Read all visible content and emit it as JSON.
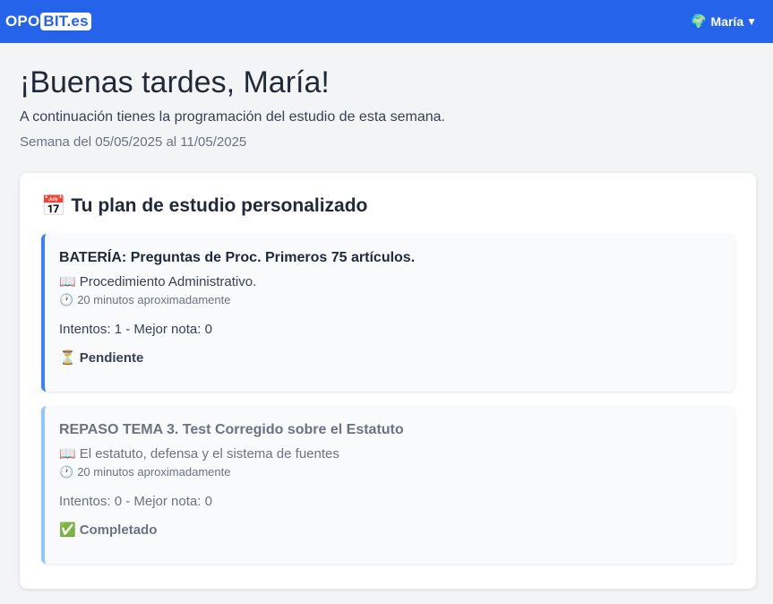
{
  "navbar": {
    "logo_part1": "OPO",
    "logo_part2": "BIT.es",
    "user_name": "María",
    "user_icon": "globe-icon",
    "caret_icon": "caret-down-icon",
    "bg_color": "#2563eb"
  },
  "header": {
    "greeting": "¡Buenas tardes, María!",
    "subtitle": "A continuación tienes la programación del estudio de esta semana.",
    "week": "Semana del 05/05/2025 al 11/05/2025"
  },
  "plan": {
    "title": "Tu plan de estudio personalizado",
    "title_icon": "calendar-icon",
    "tasks": [
      {
        "title": "BATERÍA: Preguntas de Proc. Primeros 75 artículos.",
        "topic": "Procedimiento Administrativo.",
        "time": "20 minutos aproximadamente",
        "attempts": "Intentos: 1 - Mejor nota: 0",
        "status": "Pendiente",
        "status_icon": "hourglass-icon"
      },
      {
        "title": "REPASO TEMA 3. Test Corregido sobre el Estatuto",
        "topic": "El estatuto, defensa y el sistema de fuentes",
        "time": "20 minutos aproximadamente",
        "attempts": "Intentos: 0 - Mejor nota: 0",
        "status": "Completado",
        "status_icon": "check-icon"
      }
    ]
  }
}
